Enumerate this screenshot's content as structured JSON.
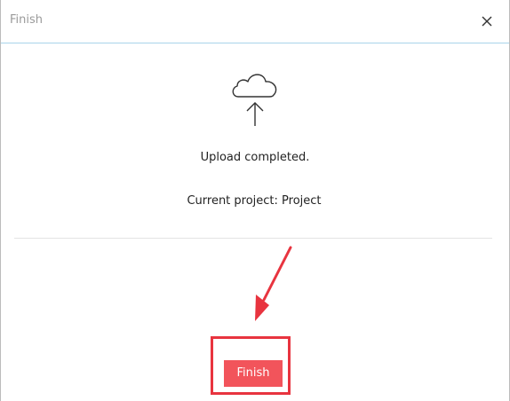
{
  "dialog": {
    "title": "Finish",
    "close_icon": "close-icon"
  },
  "content": {
    "icon": "cloud-upload-icon",
    "status": "Upload completed.",
    "project_line": "Current project: Project"
  },
  "footer": {
    "finish_label": "Finish"
  },
  "colors": {
    "title_divider": "#a9d3ea",
    "button_bg": "#f2545b",
    "annotation_red": "#e8343f"
  }
}
